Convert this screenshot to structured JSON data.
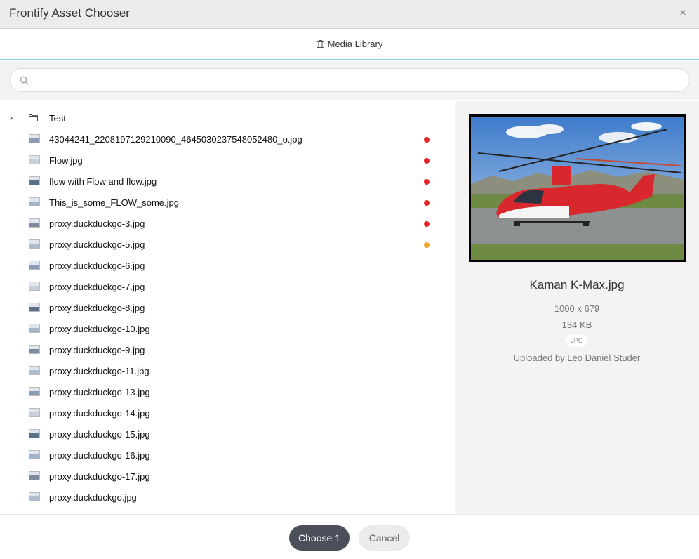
{
  "window": {
    "title": "Frontify Asset Chooser",
    "close_icon": "×"
  },
  "tabs": [
    {
      "label": "Media Library",
      "icon": "briefcase-icon"
    }
  ],
  "search": {
    "value": "",
    "placeholder": "",
    "icon": "search-icon"
  },
  "tree": {
    "folder": {
      "label": "Test",
      "expand_icon": "chevron-right-icon",
      "icon": "folder-icon"
    },
    "files": [
      {
        "label": "43044241_2208197129210090_4645030237548052480_o.jpg",
        "status": "red"
      },
      {
        "label": "Flow.jpg",
        "status": "red"
      },
      {
        "label": "flow with Flow and flow.jpg",
        "status": "red"
      },
      {
        "label": "This_is_some_FLOW_some.jpg",
        "status": "red"
      },
      {
        "label": "proxy.duckduckgo-3.jpg",
        "status": "red"
      },
      {
        "label": "proxy.duckduckgo-5.jpg",
        "status": "orange"
      },
      {
        "label": "proxy.duckduckgo-6.jpg",
        "status": ""
      },
      {
        "label": "proxy.duckduckgo-7.jpg",
        "status": ""
      },
      {
        "label": "proxy.duckduckgo-8.jpg",
        "status": ""
      },
      {
        "label": "proxy.duckduckgo-10.jpg",
        "status": ""
      },
      {
        "label": "proxy.duckduckgo-9.jpg",
        "status": ""
      },
      {
        "label": "proxy.duckduckgo-11.jpg",
        "status": ""
      },
      {
        "label": "proxy.duckduckgo-13.jpg",
        "status": ""
      },
      {
        "label": "proxy.duckduckgo-14.jpg",
        "status": ""
      },
      {
        "label": "proxy.duckduckgo-15.jpg",
        "status": ""
      },
      {
        "label": "proxy.duckduckgo-16.jpg",
        "status": ""
      },
      {
        "label": "proxy.duckduckgo-17.jpg",
        "status": ""
      },
      {
        "label": "proxy.duckduckgo.jpg",
        "status": ""
      }
    ]
  },
  "preview": {
    "filename": "Kaman K-Max.jpg",
    "dimensions": "1000 x 679",
    "filesize": "134 KB",
    "format": "JPG",
    "uploader": "Uploaded by Leo Daniel Studer"
  },
  "footer": {
    "choose_label": "Choose 1",
    "cancel_label": "Cancel"
  },
  "colors": {
    "status_red": "#e8262a",
    "status_orange": "#f5a623",
    "accent_line": "#7fd0e8",
    "primary_button": "#4a4f59"
  }
}
